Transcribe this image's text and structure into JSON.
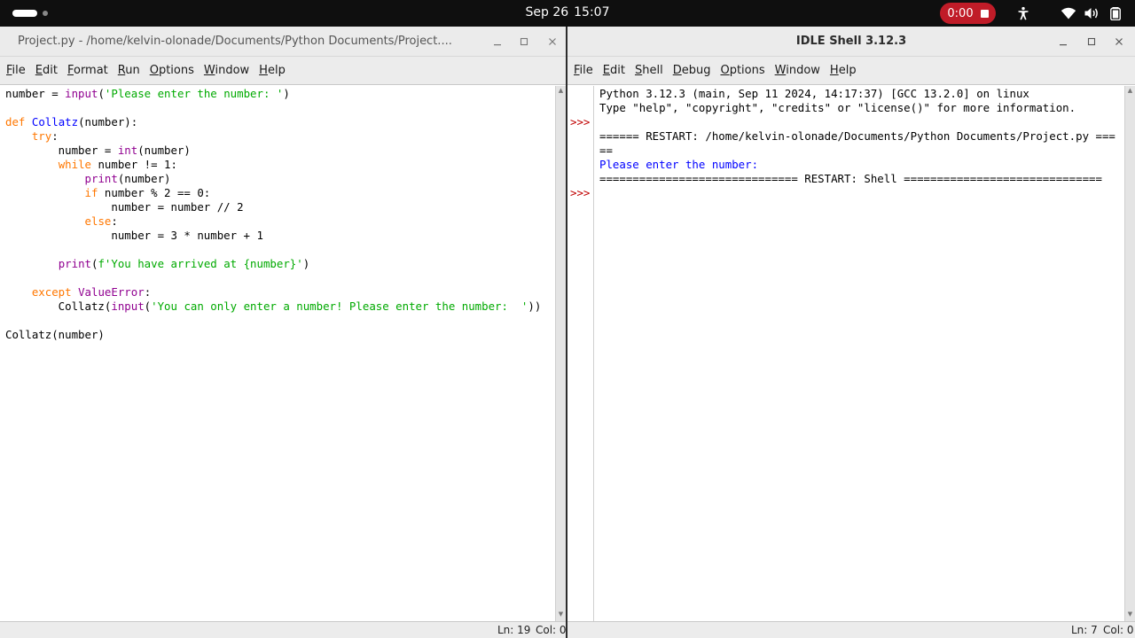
{
  "topbar": {
    "date": "Sep 26",
    "time": "15:07",
    "recording_time": "0:00"
  },
  "editor_window": {
    "title": "Project.py - /home/kelvin-olonade/Documents/Python Documents/Project....",
    "menu": [
      "File",
      "Edit",
      "Format",
      "Run",
      "Options",
      "Window",
      "Help"
    ],
    "code": {
      "l1_a": "number = ",
      "l1_b": "input",
      "l1_c": "(",
      "l1_d": "'Please enter the number: '",
      "l1_e": ")",
      "l3_a": "def",
      "l3_b": " ",
      "l3_c": "Collatz",
      "l3_d": "(number):",
      "l4_a": "    ",
      "l4_b": "try",
      "l4_c": ":",
      "l5_a": "        number = ",
      "l5_b": "int",
      "l5_c": "(number)",
      "l6_a": "        ",
      "l6_b": "while",
      "l6_c": " number != 1:",
      "l7_a": "            ",
      "l7_b": "print",
      "l7_c": "(number)",
      "l8_a": "            ",
      "l8_b": "if",
      "l8_c": " number % 2 == 0:",
      "l9": "                number = number // 2",
      "l10_a": "            ",
      "l10_b": "else",
      "l10_c": ":",
      "l11": "                number = 3 * number + 1",
      "l13_a": "        ",
      "l13_b": "print",
      "l13_c": "(",
      "l13_d": "f'You have arrived at {number}'",
      "l13_e": ")",
      "l15_a": "    ",
      "l15_b": "except",
      "l15_c": " ",
      "l15_d": "ValueError",
      "l15_e": ":",
      "l16_a": "        Collatz(",
      "l16_b": "input",
      "l16_c": "(",
      "l16_d": "'You can only enter a number! Please enter the number:  '",
      "l16_e": "))",
      "l18": "Collatz(number)"
    },
    "status": {
      "line": "Ln: 19",
      "col": "Col: 0"
    }
  },
  "shell_window": {
    "title": "IDLE Shell 3.12.3",
    "menu": [
      "File",
      "Edit",
      "Shell",
      "Debug",
      "Options",
      "Window",
      "Help"
    ],
    "prompt": ">>>",
    "lines": {
      "l1": "Python 3.12.3 (main, Sep 11 2024, 14:17:37) [GCC 13.2.0] on linux",
      "l2": "Type \"help\", \"copyright\", \"credits\" or \"license()\" for more information.",
      "l4": "====== RESTART: /home/kelvin-olonade/Documents/Python Documents/Project.py ===",
      "l5": "==",
      "l6": "Please enter the number: ",
      "l7": "============================== RESTART: Shell =============================="
    },
    "status": {
      "line": "Ln: 7",
      "col": "Col: 0"
    }
  },
  "colors": {
    "keyword": "#ff7700",
    "builtin": "#900090",
    "string": "#00aa00",
    "definition": "#0000ff",
    "stdout": "#0000ff",
    "prompt": "#c00000",
    "record": "#c01c28"
  }
}
